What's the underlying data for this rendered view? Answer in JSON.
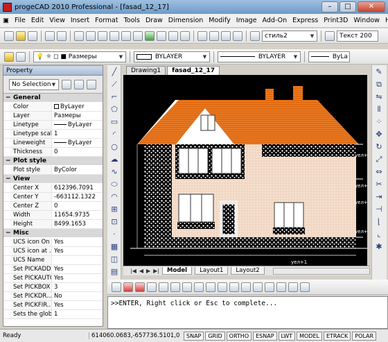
{
  "window": {
    "title": "progeCAD 2010 Professional - [fasad_12_17]"
  },
  "menu": [
    "File",
    "Edit",
    "View",
    "Insert",
    "Format",
    "Tools",
    "Draw",
    "Dimension",
    "Modify",
    "Image",
    "Add-On",
    "Express",
    "Print3D",
    "Window",
    "Help"
  ],
  "toolbar1": {
    "textstyle": "стиль2",
    "text_label": "Текст 200"
  },
  "toolbar2": {
    "layer": "Размеры",
    "color": "BYLAYER",
    "linetype": "BYLAYER",
    "lineweight": "ByLa"
  },
  "property": {
    "title": "Property",
    "selection": "No Selection",
    "sections": [
      {
        "name": "General",
        "rows": [
          [
            "Color",
            "ByLayer"
          ],
          [
            "Layer",
            "Размеры"
          ],
          [
            "Linetype",
            "ByLayer"
          ],
          [
            "Linetype scale",
            "1"
          ],
          [
            "Lineweight",
            "ByLayer"
          ],
          [
            "Thickness",
            "0"
          ]
        ]
      },
      {
        "name": "Plot style",
        "rows": [
          [
            "Plot style",
            "ByColor"
          ]
        ]
      },
      {
        "name": "View",
        "rows": [
          [
            "Center X",
            "612396.7091"
          ],
          [
            "Center Y",
            "-663112.1322"
          ],
          [
            "Center Z",
            "0"
          ],
          [
            "Width",
            "11654.9735"
          ],
          [
            "Height",
            "8499.1653"
          ]
        ]
      },
      {
        "name": "Misc",
        "rows": [
          [
            "UCS icon On",
            "Yes"
          ],
          [
            "UCS icon at ...",
            "Yes"
          ],
          [
            "UCS Name",
            ""
          ],
          [
            "Set PICKADD",
            "Yes"
          ],
          [
            "Set PICKAUTO",
            "Yes"
          ],
          [
            "Set PICKBOX",
            "3"
          ],
          [
            "Set PICKDR...",
            "No"
          ],
          [
            "Set PICKFIR...",
            "Yes"
          ],
          [
            "Sets the glob...",
            "1"
          ]
        ]
      }
    ]
  },
  "tabs": [
    "Drawing1",
    "fasad_12_17"
  ],
  "layout_tabs": [
    "Model",
    "Layout1",
    "Layout2"
  ],
  "drawing_labels": {
    "l1": "уел+1",
    "l2": "уел+1",
    "l3": "уел+1",
    "l4": "уел+1",
    "l5": "уел+1"
  },
  "command": {
    "text": ">>ENTER, Right click or Esc to complete..."
  },
  "status": {
    "ready": "Ready",
    "coords": "614060.0683,-657736.5101,0",
    "buttons": [
      "SNAP",
      "GRID",
      "ORTHO",
      "ESNAP",
      "LWT",
      "MODEL",
      "ETRACK",
      "POLAR"
    ]
  },
  "colors": {
    "roof": "#e07820",
    "wall": "#f2d8c4",
    "stone": "#ffffff",
    "background": "#000000"
  }
}
